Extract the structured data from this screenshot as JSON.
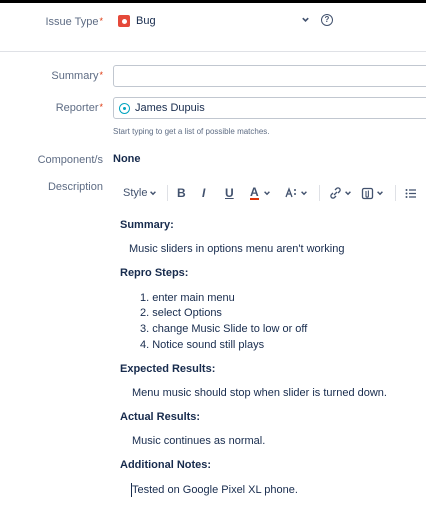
{
  "form": {
    "issue_type_label": "Issue Type",
    "issue_type_value": "Bug",
    "summary_label": "Summary",
    "summary_value": "",
    "reporter_label": "Reporter",
    "reporter_value": "James Dupuis",
    "reporter_hint": "Start typing to get a list of possible matches.",
    "components_label": "Component/s",
    "components_value": "None",
    "description_label": "Description",
    "required_mark": "*"
  },
  "toolbar": {
    "style_label": "Style",
    "bold": "B",
    "italic": "I",
    "underline": "U",
    "text_color": "A"
  },
  "description": {
    "summary_heading": "Summary:",
    "summary_text": "Music sliders in options menu aren't working",
    "repro_heading": "Repro Steps:",
    "repro_steps": [
      "1. enter main menu",
      "2. select Options",
      "3. change Music Slide to low or off",
      "4. Notice sound still plays"
    ],
    "expected_heading": "Expected Results:",
    "expected_text": "Menu music should stop when slider is turned down.",
    "actual_heading": "Actual Results:",
    "actual_text": "Music continues as normal.",
    "notes_heading": "Additional Notes:",
    "notes_text": "Tested on Google Pixel XL phone."
  },
  "colors": {
    "bug_icon": "#e5493a",
    "required": "#de350b",
    "text_color_underline": "#de350b",
    "avatar": "#00a3bf"
  },
  "icons": [
    "bug-icon",
    "chevron-down-icon",
    "help-icon",
    "avatar-icon",
    "text-style-icon",
    "link-icon",
    "attachment-icon",
    "bullet-list-icon"
  ]
}
